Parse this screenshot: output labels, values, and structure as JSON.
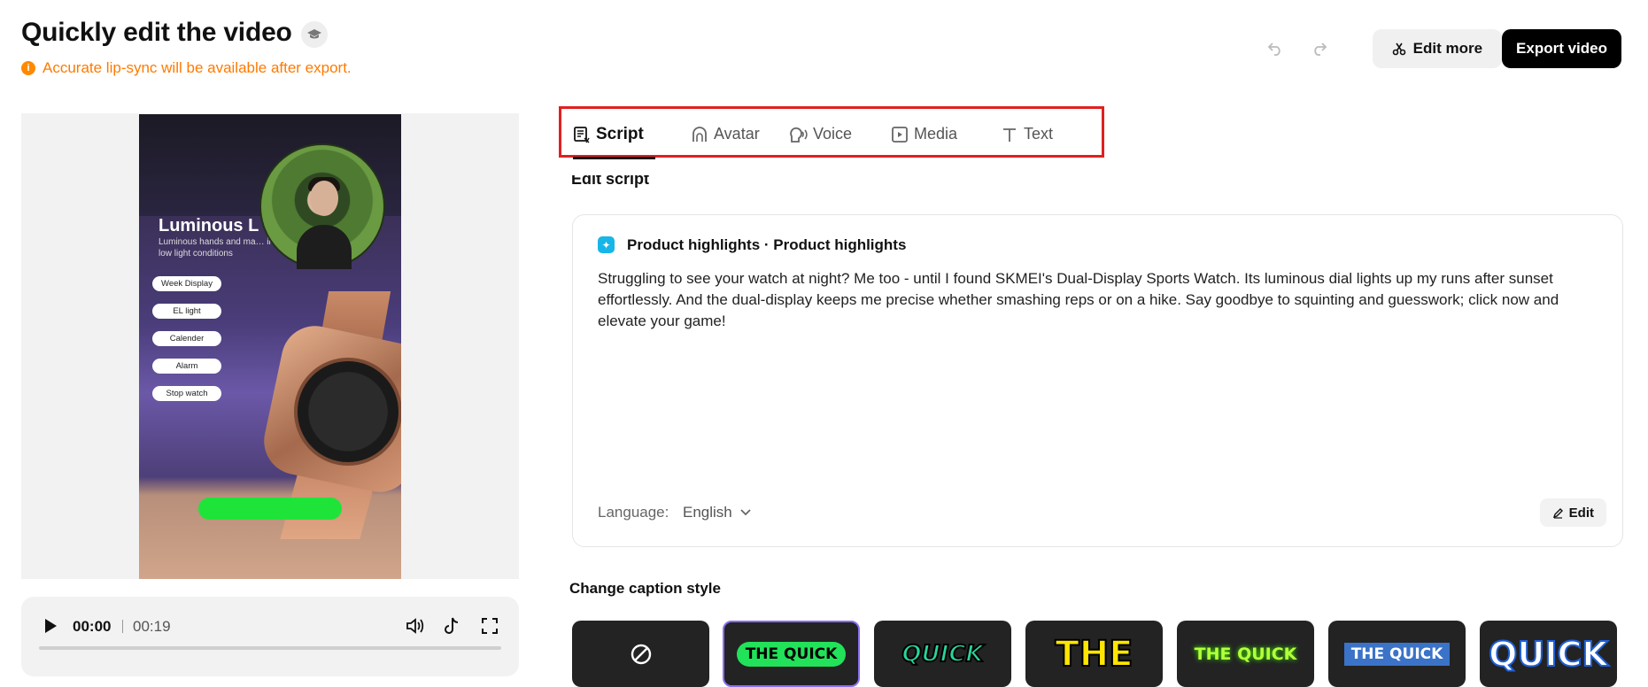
{
  "header": {
    "title": "Quickly edit the video",
    "notice": "Accurate lip-sync will be available after export.",
    "notice_icon": "info-icon",
    "edit_more_label": "Edit more",
    "export_label": "Export video"
  },
  "preview": {
    "product_title": "Luminous L",
    "product_subtitle": "Luminous hands and ma… in low light conditions",
    "features": [
      "Week Display",
      "EL light",
      "Calender",
      "Alarm",
      "Stop watch"
    ]
  },
  "player": {
    "current_time": "00:00",
    "total_time": "00:19",
    "progress": 0
  },
  "tabs": [
    {
      "label": "Script",
      "icon": "script-icon",
      "active": true
    },
    {
      "label": "Avatar",
      "icon": "avatar-icon",
      "active": false
    },
    {
      "label": "Voice",
      "icon": "voice-icon",
      "active": false
    },
    {
      "label": "Media",
      "icon": "media-icon",
      "active": false
    },
    {
      "label": "Text",
      "icon": "text-icon",
      "active": false
    }
  ],
  "script": {
    "section_label": "Edit script",
    "heading": "Product highlights · Product highlights",
    "body": "Struggling to see your watch at night? Me too - until I found SKMEI's Dual-Display Sports Watch. Its luminous dial lights up my runs after sunset effortlessly. And the dual-display keeps me precise whether smashing reps or on a hike. Say goodbye to squinting and guesswork; click now and elevate your game!",
    "language_label": "Language:",
    "language_value": "English",
    "edit_label": "Edit"
  },
  "captions": {
    "title": "Change caption style",
    "options": [
      {
        "id": "none",
        "text": ""
      },
      {
        "id": "green-pill",
        "text": "THE QUICK",
        "selected": true
      },
      {
        "id": "teal-italic",
        "text": "QUICK"
      },
      {
        "id": "yellow-bold",
        "text": "THE"
      },
      {
        "id": "green-glow",
        "text": "THE QUICK"
      },
      {
        "id": "blue-box",
        "text": "THE QUICK"
      },
      {
        "id": "white-outline",
        "text": "QUICK"
      }
    ]
  },
  "colors": {
    "accent_notice": "#ff7a00",
    "highlight_border": "#e02020",
    "selected_caption": "#8a6ef0"
  }
}
